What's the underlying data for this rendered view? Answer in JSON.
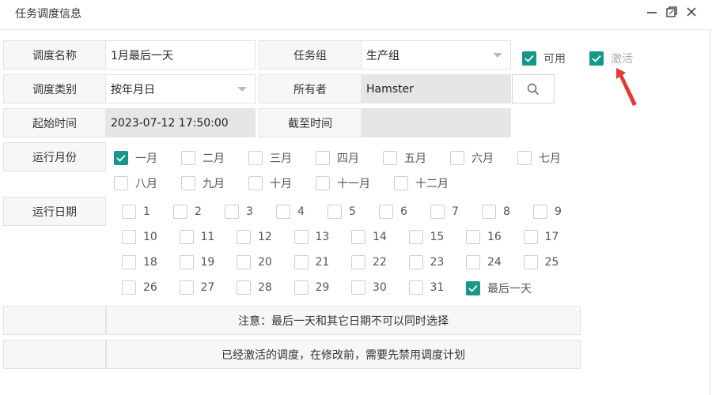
{
  "window": {
    "title": "任务调度信息",
    "minimize_icon": "minimize-icon",
    "maximize_icon": "restore-icon",
    "close_icon": "close-icon"
  },
  "form": {
    "name_label": "调度名称",
    "name_value": "1月最后一天",
    "group_label": "任务组",
    "group_value": "生产组",
    "enabled_label": "可用",
    "activated_label": "激活",
    "type_label": "调度类别",
    "type_value": "按年月日",
    "owner_label": "所有者",
    "owner_value": "Hamster",
    "start_label": "起始时间",
    "start_value": "2023-07-12 17:50:00",
    "end_label": "截至时间",
    "end_value": "",
    "months_label": "运行月份",
    "days_label": "运行日期"
  },
  "months": [
    {
      "label": "一月",
      "checked": true
    },
    {
      "label": "二月",
      "checked": false
    },
    {
      "label": "三月",
      "checked": false
    },
    {
      "label": "四月",
      "checked": false
    },
    {
      "label": "五月",
      "checked": false
    },
    {
      "label": "六月",
      "checked": false
    },
    {
      "label": "七月",
      "checked": false
    },
    {
      "label": "八月",
      "checked": false
    },
    {
      "label": "九月",
      "checked": false
    },
    {
      "label": "十月",
      "checked": false
    },
    {
      "label": "十一月",
      "checked": false
    },
    {
      "label": "十二月",
      "checked": false
    }
  ],
  "days": [
    {
      "label": "1",
      "checked": false
    },
    {
      "label": "2",
      "checked": false
    },
    {
      "label": "3",
      "checked": false
    },
    {
      "label": "4",
      "checked": false
    },
    {
      "label": "5",
      "checked": false
    },
    {
      "label": "6",
      "checked": false
    },
    {
      "label": "7",
      "checked": false
    },
    {
      "label": "8",
      "checked": false
    },
    {
      "label": "9",
      "checked": false
    },
    {
      "label": "10",
      "checked": false
    },
    {
      "label": "11",
      "checked": false
    },
    {
      "label": "12",
      "checked": false
    },
    {
      "label": "13",
      "checked": false
    },
    {
      "label": "14",
      "checked": false
    },
    {
      "label": "15",
      "checked": false
    },
    {
      "label": "16",
      "checked": false
    },
    {
      "label": "17",
      "checked": false
    },
    {
      "label": "18",
      "checked": false
    },
    {
      "label": "19",
      "checked": false
    },
    {
      "label": "20",
      "checked": false
    },
    {
      "label": "21",
      "checked": false
    },
    {
      "label": "22",
      "checked": false
    },
    {
      "label": "23",
      "checked": false
    },
    {
      "label": "24",
      "checked": false
    },
    {
      "label": "25",
      "checked": false
    },
    {
      "label": "26",
      "checked": false
    },
    {
      "label": "27",
      "checked": false
    },
    {
      "label": "28",
      "checked": false
    },
    {
      "label": "29",
      "checked": false
    },
    {
      "label": "30",
      "checked": false
    },
    {
      "label": "31",
      "checked": false
    },
    {
      "label": "最后一天",
      "checked": true
    }
  ],
  "notes": {
    "note1": "注意：最后一天和其它日期不可以同时选择",
    "note2": "已经激活的调度，在修改前，需要先禁用调度计划"
  },
  "colors": {
    "accent": "#16978a",
    "arrow": "#e53935"
  }
}
